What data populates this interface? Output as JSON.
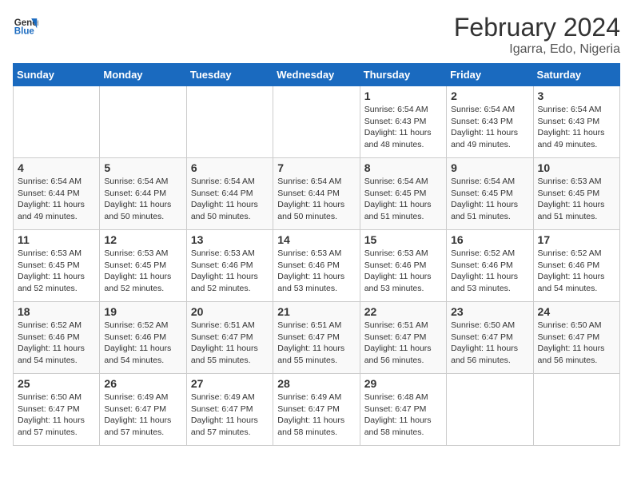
{
  "header": {
    "logo_line1": "General",
    "logo_line2": "Blue",
    "main_title": "February 2024",
    "subtitle": "Igarra, Edo, Nigeria"
  },
  "days_of_week": [
    "Sunday",
    "Monday",
    "Tuesday",
    "Wednesday",
    "Thursday",
    "Friday",
    "Saturday"
  ],
  "weeks": [
    [
      {
        "day": "",
        "info": ""
      },
      {
        "day": "",
        "info": ""
      },
      {
        "day": "",
        "info": ""
      },
      {
        "day": "",
        "info": ""
      },
      {
        "day": "1",
        "info": "Sunrise: 6:54 AM\nSunset: 6:43 PM\nDaylight: 11 hours\nand 48 minutes."
      },
      {
        "day": "2",
        "info": "Sunrise: 6:54 AM\nSunset: 6:43 PM\nDaylight: 11 hours\nand 49 minutes."
      },
      {
        "day": "3",
        "info": "Sunrise: 6:54 AM\nSunset: 6:43 PM\nDaylight: 11 hours\nand 49 minutes."
      }
    ],
    [
      {
        "day": "4",
        "info": "Sunrise: 6:54 AM\nSunset: 6:44 PM\nDaylight: 11 hours\nand 49 minutes."
      },
      {
        "day": "5",
        "info": "Sunrise: 6:54 AM\nSunset: 6:44 PM\nDaylight: 11 hours\nand 50 minutes."
      },
      {
        "day": "6",
        "info": "Sunrise: 6:54 AM\nSunset: 6:44 PM\nDaylight: 11 hours\nand 50 minutes."
      },
      {
        "day": "7",
        "info": "Sunrise: 6:54 AM\nSunset: 6:44 PM\nDaylight: 11 hours\nand 50 minutes."
      },
      {
        "day": "8",
        "info": "Sunrise: 6:54 AM\nSunset: 6:45 PM\nDaylight: 11 hours\nand 51 minutes."
      },
      {
        "day": "9",
        "info": "Sunrise: 6:54 AM\nSunset: 6:45 PM\nDaylight: 11 hours\nand 51 minutes."
      },
      {
        "day": "10",
        "info": "Sunrise: 6:53 AM\nSunset: 6:45 PM\nDaylight: 11 hours\nand 51 minutes."
      }
    ],
    [
      {
        "day": "11",
        "info": "Sunrise: 6:53 AM\nSunset: 6:45 PM\nDaylight: 11 hours\nand 52 minutes."
      },
      {
        "day": "12",
        "info": "Sunrise: 6:53 AM\nSunset: 6:45 PM\nDaylight: 11 hours\nand 52 minutes."
      },
      {
        "day": "13",
        "info": "Sunrise: 6:53 AM\nSunset: 6:46 PM\nDaylight: 11 hours\nand 52 minutes."
      },
      {
        "day": "14",
        "info": "Sunrise: 6:53 AM\nSunset: 6:46 PM\nDaylight: 11 hours\nand 53 minutes."
      },
      {
        "day": "15",
        "info": "Sunrise: 6:53 AM\nSunset: 6:46 PM\nDaylight: 11 hours\nand 53 minutes."
      },
      {
        "day": "16",
        "info": "Sunrise: 6:52 AM\nSunset: 6:46 PM\nDaylight: 11 hours\nand 53 minutes."
      },
      {
        "day": "17",
        "info": "Sunrise: 6:52 AM\nSunset: 6:46 PM\nDaylight: 11 hours\nand 54 minutes."
      }
    ],
    [
      {
        "day": "18",
        "info": "Sunrise: 6:52 AM\nSunset: 6:46 PM\nDaylight: 11 hours\nand 54 minutes."
      },
      {
        "day": "19",
        "info": "Sunrise: 6:52 AM\nSunset: 6:46 PM\nDaylight: 11 hours\nand 54 minutes."
      },
      {
        "day": "20",
        "info": "Sunrise: 6:51 AM\nSunset: 6:47 PM\nDaylight: 11 hours\nand 55 minutes."
      },
      {
        "day": "21",
        "info": "Sunrise: 6:51 AM\nSunset: 6:47 PM\nDaylight: 11 hours\nand 55 minutes."
      },
      {
        "day": "22",
        "info": "Sunrise: 6:51 AM\nSunset: 6:47 PM\nDaylight: 11 hours\nand 56 minutes."
      },
      {
        "day": "23",
        "info": "Sunrise: 6:50 AM\nSunset: 6:47 PM\nDaylight: 11 hours\nand 56 minutes."
      },
      {
        "day": "24",
        "info": "Sunrise: 6:50 AM\nSunset: 6:47 PM\nDaylight: 11 hours\nand 56 minutes."
      }
    ],
    [
      {
        "day": "25",
        "info": "Sunrise: 6:50 AM\nSunset: 6:47 PM\nDaylight: 11 hours\nand 57 minutes."
      },
      {
        "day": "26",
        "info": "Sunrise: 6:49 AM\nSunset: 6:47 PM\nDaylight: 11 hours\nand 57 minutes."
      },
      {
        "day": "27",
        "info": "Sunrise: 6:49 AM\nSunset: 6:47 PM\nDaylight: 11 hours\nand 57 minutes."
      },
      {
        "day": "28",
        "info": "Sunrise: 6:49 AM\nSunset: 6:47 PM\nDaylight: 11 hours\nand 58 minutes."
      },
      {
        "day": "29",
        "info": "Sunrise: 6:48 AM\nSunset: 6:47 PM\nDaylight: 11 hours\nand 58 minutes."
      },
      {
        "day": "",
        "info": ""
      },
      {
        "day": "",
        "info": ""
      }
    ]
  ]
}
